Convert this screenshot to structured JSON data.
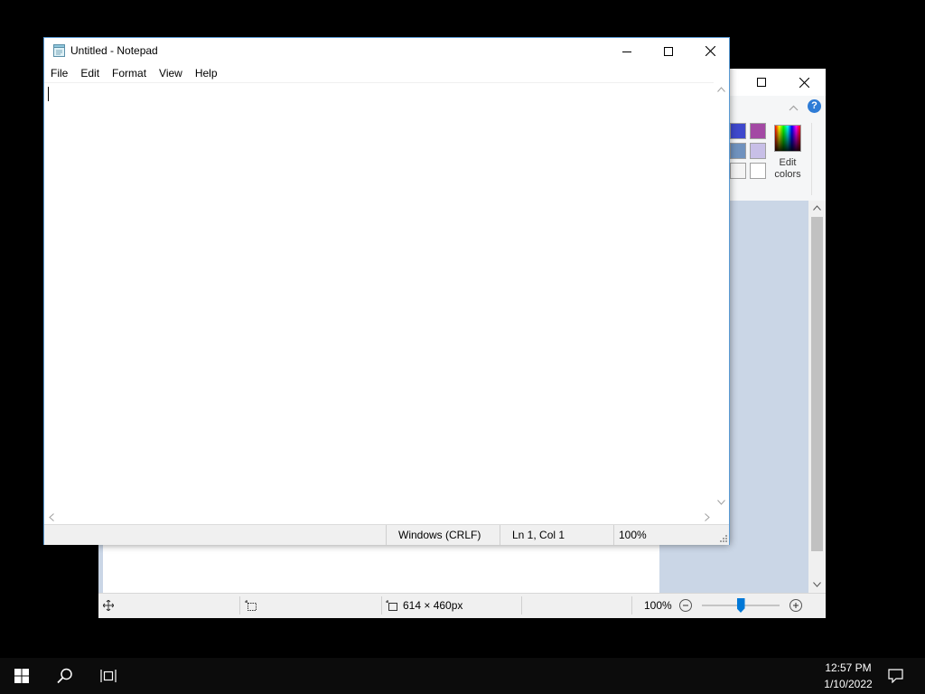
{
  "notepad": {
    "title": "Untitled - Notepad",
    "menu": [
      "File",
      "Edit",
      "Format",
      "View",
      "Help"
    ],
    "content": "",
    "status": {
      "line_ending": "Windows (CRLF)",
      "position": "Ln 1, Col 1",
      "zoom": "100%"
    }
  },
  "paint": {
    "edit_colors_label": "Edit colors",
    "palette_colors": [
      "#3f48cc",
      "#a349a4",
      "#7092be",
      "#c8bfe7",
      "#f4f4f4",
      "#ffffff"
    ],
    "status": {
      "image_size": "614 × 460px",
      "zoom": "100%",
      "zoom_slider_level": 0.5
    }
  },
  "taskbar": {
    "time": "12:57 PM",
    "date": "1/10/2022"
  },
  "colors": {
    "accent": "#0078d7",
    "help_icon": "#2e7cd6",
    "canvas_bg": "#cad6e6"
  }
}
